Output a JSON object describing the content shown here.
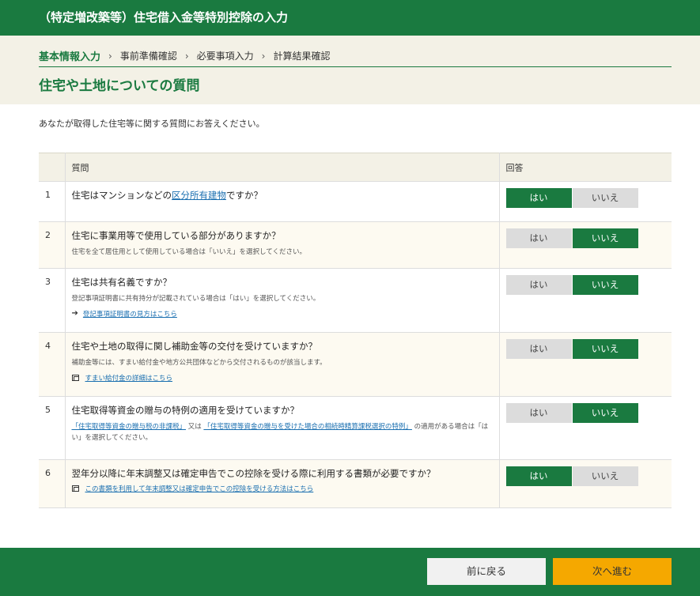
{
  "header": {
    "title": "（特定増改築等）住宅借入金等特別控除の入力"
  },
  "steps": [
    "基本情報入力",
    "事前準備確認",
    "必要事項入力",
    "計算結果確認"
  ],
  "step_separator": "›",
  "page_title": "住宅や土地についての質問",
  "intro": "あなたが取得した住宅等に関する質問にお答えください。",
  "table": {
    "col_question": "質問",
    "col_answer": "回答",
    "yes_label": "はい",
    "no_label": "いいえ",
    "rows": [
      {
        "num": "1",
        "q_pre": "住宅はマンションなどの",
        "q_link": "区分所有建物",
        "q_post": "ですか？",
        "answer": "はい"
      },
      {
        "num": "2",
        "question": "住宅に事業用等で使用している部分がありますか？",
        "note": "住宅を全て居住用として使用している場合は「いいえ」を選択してください。",
        "answer": "いいえ"
      },
      {
        "num": "3",
        "question": "住宅は共有名義ですか？",
        "note": "登記事項証明書に共有持分が記載されている場合は「はい」を選択してください。",
        "link": "登記事項証明書の見方はこちら",
        "answer": "いいえ"
      },
      {
        "num": "4",
        "question": "住宅や土地の取得に関し補助金等の交付を受けていますか？",
        "note": "補助金等には、すまい給付金や地方公共団体などから交付されるものが該当します。",
        "link": "すまい給付金の詳細はこちら",
        "answer": "いいえ"
      },
      {
        "num": "5",
        "question": "住宅取得等資金の贈与の特例の適用を受けていますか？",
        "link1": "「住宅取得等資金の贈与税の非課税」",
        "mid": " 又は ",
        "link2": "「住宅取得等資金の贈与を受けた場合の相続時精算課税選択の特例」",
        "tail": " の適用がある場合は「はい」を選択してください。",
        "answer": "いいえ"
      },
      {
        "num": "6",
        "question": "翌年分以降に年末調整又は確定申告でこの控除を受ける際に利用する書類が必要ですか？",
        "link": "この書類を利用して年末調整又は確定申告でこの控除を受ける方法はこちら",
        "answer": "はい"
      }
    ]
  },
  "footer": {
    "back_label": "前に戻る",
    "next_label": "次へ進む"
  },
  "colors": {
    "brand_green": "#1a7a40",
    "accent_orange": "#f5a800",
    "header_bg": "#f3f1e6"
  }
}
